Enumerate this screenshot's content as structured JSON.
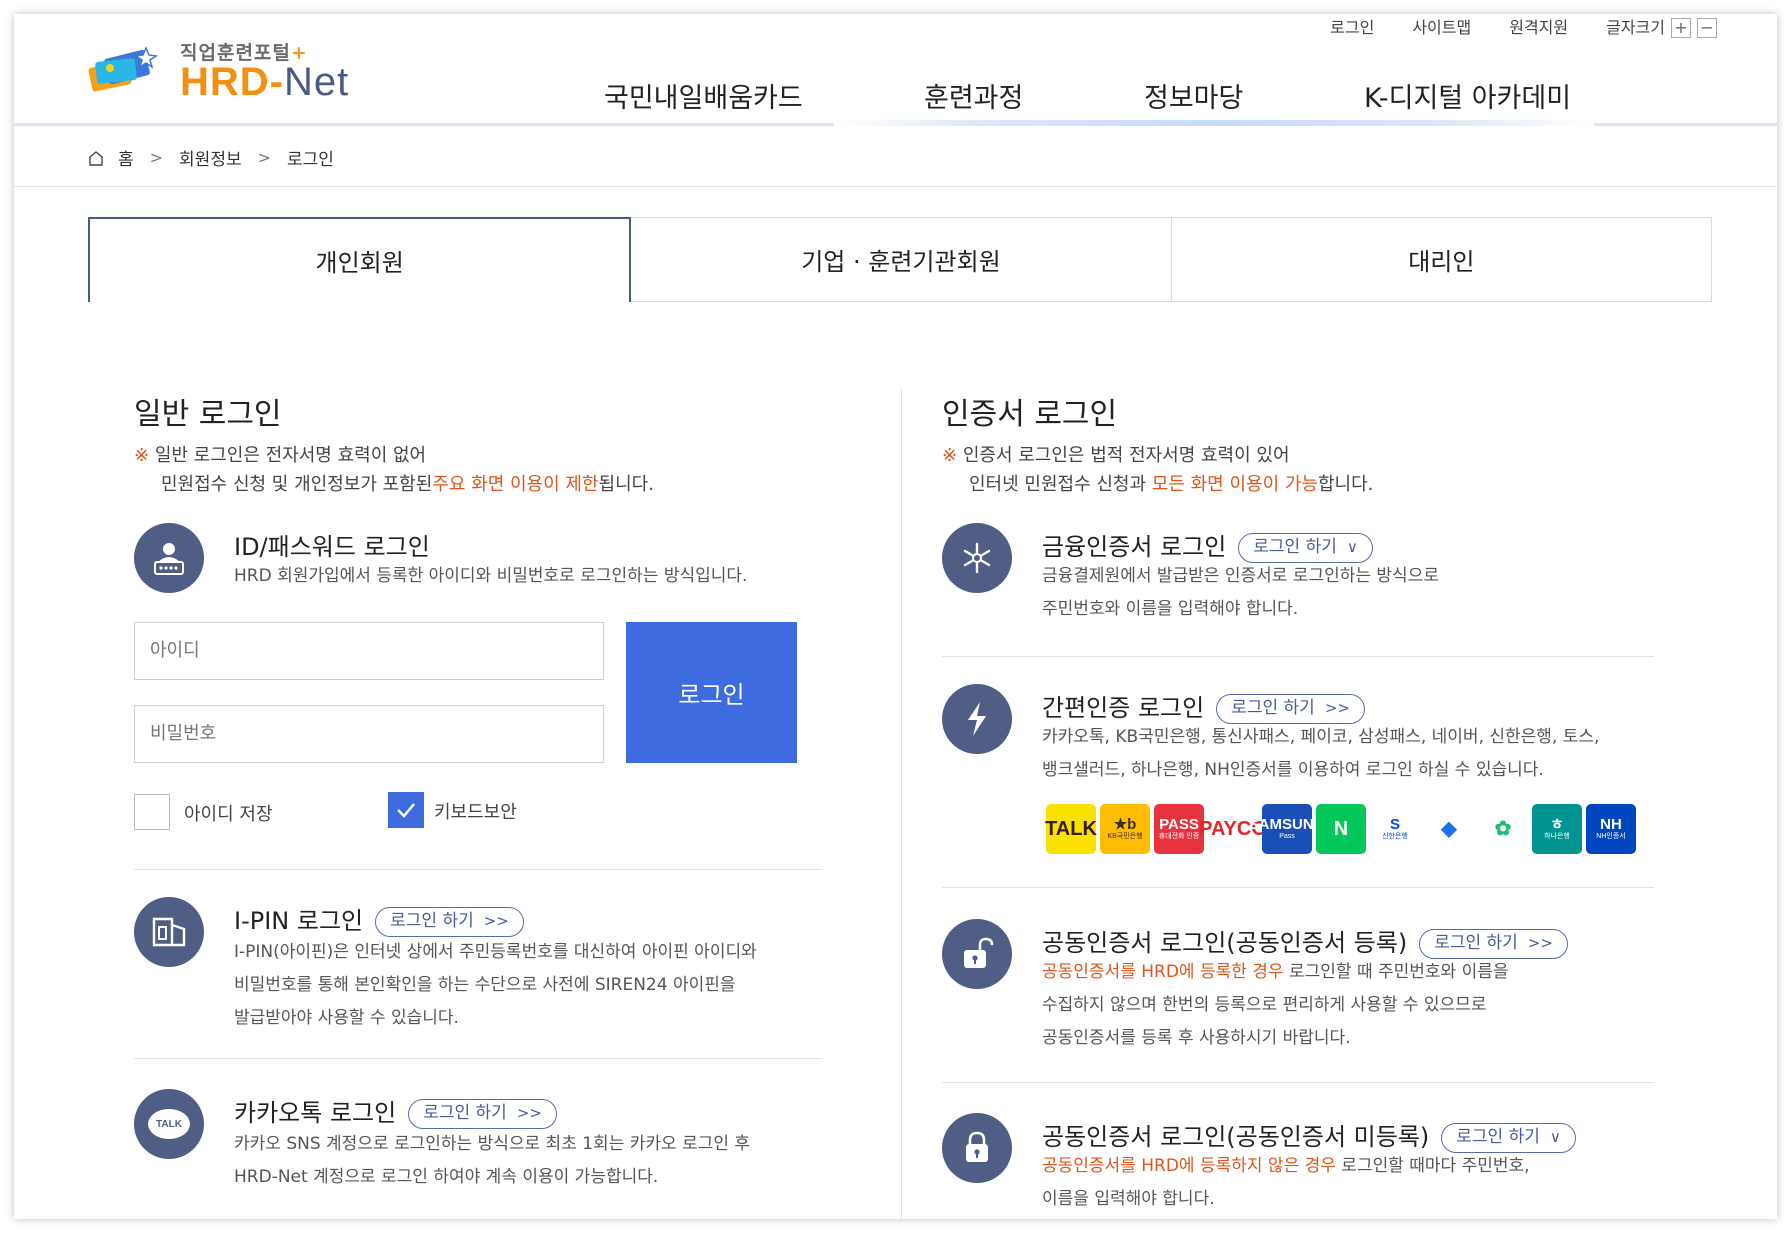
{
  "logo": {
    "subtitle": "직업훈련포털",
    "plus": "+",
    "brand_main": "HRD-",
    "brand_net": "Net"
  },
  "util": {
    "login": "로그인",
    "sitemap": "사이트맵",
    "remote": "원격지원",
    "font_size": "글자크기",
    "font_up": "+",
    "font_down": "−"
  },
  "gnb": [
    "국민내일배움카드",
    "훈련과정",
    "정보마당",
    "K-디지털 아카데미"
  ],
  "breadcrumb": {
    "home": "홈",
    "sep": ">",
    "level1": "회원정보",
    "level2": "로그인"
  },
  "tabs": [
    "개인회원",
    "기업 · 훈련기관회원",
    "대리인"
  ],
  "left": {
    "title": "일반 로그인",
    "notice_mark": "※",
    "notice_line1": "일반 로그인은 전자서명 효력이 없어",
    "notice_line2a": "민원접수 신청 및 개인정보가 포함된",
    "notice_line2b": "주요 화면 이용이 제한",
    "notice_line2c": "됩니다.",
    "id_login": {
      "title": "ID/패스워드 로그인",
      "desc": "HRD 회원가입에서 등록한 아이디와 비밀번호로 로그인하는 방식입니다.",
      "id_placeholder": "아이디",
      "pw_placeholder": "비밀번호",
      "button": "로그인",
      "save_id": "아이디 저장",
      "keyboard_security": "키보드보안"
    },
    "ipin": {
      "title": "I-PIN 로그인",
      "pill": "로그인 하기",
      "pill_arrow": ">>",
      "desc1": "I-PIN(아이핀)은 인터넷 상에서 주민등록번호를 대신하여 아이핀 아이디와",
      "desc2": "비밀번호를 통해 본인확인을 하는 수단으로 사전에 SIREN24 아이핀을",
      "desc3": "발급받아야 사용할 수 있습니다."
    },
    "kakao": {
      "title": "카카오톡 로그인",
      "pill": "로그인 하기",
      "pill_arrow": ">>",
      "icon_text": "TALK",
      "desc1": "카카오 SNS 계정으로 로그인하는 방식으로 최초 1회는 카카오 로그인 후",
      "desc2": "HRD-Net 계정으로 로그인 하여야 계속 이용이 가능합니다."
    }
  },
  "right": {
    "title": "인증서 로그인",
    "notice_mark": "※",
    "notice_line1": "인증서 로그인은 법적 전자서명 효력이 있어",
    "notice_line2a": "인터넷 민원접수 신청과",
    "notice_line2b": "모든 화면 이용이 가능",
    "notice_line2c": "합니다.",
    "financial": {
      "title": "금융인증서 로그인",
      "pill": "로그인 하기",
      "pill_arrow": "∨",
      "desc1": "금융결제원에서 발급받은 인증서로 로그인하는 방식으로",
      "desc2": "주민번호와 이름을 입력해야 합니다."
    },
    "simple": {
      "title": "간편인증 로그인",
      "pill": "로그인 하기",
      "pill_arrow": ">>",
      "desc1": "카카오톡, KB국민은행, 통신사패스, 페이코, 삼성패스, 네이버, 신한은행, 토스,",
      "desc2": "뱅크샐러드, 하나은행, NH인증서를 이용하여 로그인 하실 수 있습니다.",
      "brands": [
        {
          "name": "kakaotalk-logo",
          "line1": "TALK",
          "line2": "",
          "bg": "#fae100",
          "fg": "#3a1d1d"
        },
        {
          "name": "kb-logo",
          "line1": "★b",
          "line2": "KB국민은행",
          "bg": "#ffbc00",
          "fg": "#3b3026"
        },
        {
          "name": "pass-logo",
          "line1": "PASS",
          "line2": "휴대전화 인증",
          "bg": "#e8323e",
          "fg": "#ffffff"
        },
        {
          "name": "payco-logo",
          "line1": "PAYCO",
          "line2": "",
          "bg": "#ffffff",
          "fg": "#e3262a"
        },
        {
          "name": "samsung-pass-logo",
          "line1": "SAMSUNG",
          "line2": "Pass",
          "bg": "#1a4fb8",
          "fg": "#ffffff"
        },
        {
          "name": "naver-logo",
          "line1": "N",
          "line2": "",
          "bg": "#03c75a",
          "fg": "#ffffff"
        },
        {
          "name": "shinhan-logo",
          "line1": "S",
          "line2": "신한은행",
          "bg": "#ffffff",
          "fg": "#0046ff"
        },
        {
          "name": "toss-logo",
          "line1": "◆",
          "line2": "",
          "bg": "#ffffff",
          "fg": "#1a73e8"
        },
        {
          "name": "banksalad-logo",
          "line1": "✿",
          "line2": "",
          "bg": "#ffffff",
          "fg": "#1dbf73"
        },
        {
          "name": "hana-logo",
          "line1": "ㅎ",
          "line2": "하나은행",
          "bg": "#009490",
          "fg": "#ffffff"
        },
        {
          "name": "nh-logo",
          "line1": "NH",
          "line2": "NH인증서",
          "bg": "#0046be",
          "fg": "#ffffff"
        }
      ]
    },
    "joint_reg": {
      "title": "공동인증서 로그인(공동인증서 등록)",
      "pill": "로그인 하기",
      "pill_arrow": ">>",
      "desc1_hl": "공동인증서를 HRD에 등록한 경우",
      "desc1_rest": " 로그인할 때 주민번호와 이름을",
      "desc2": "수집하지 않으며 한번의 등록으로 편리하게 사용할 수 있으므로",
      "desc3": "공동인증서를 등록 후 사용하시기 바랍니다."
    },
    "joint_unreg": {
      "title": "공동인증서 로그인(공동인증서 미등록)",
      "pill": "로그인 하기",
      "pill_arrow": "∨",
      "desc1_hl": "공동인증서를 HRD에 등록하지 않은 경우",
      "desc1_rest": " 로그인할 때마다 주민번호,",
      "desc2": "이름을 입력해야 합니다."
    }
  }
}
